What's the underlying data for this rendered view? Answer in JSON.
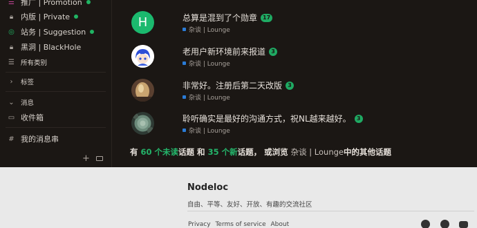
{
  "sidebar": {
    "items": [
      {
        "label": "推广 | Promotion",
        "icon": "list-icon",
        "dot": true
      },
      {
        "label": "内版 | Private",
        "icon": "lock-icon",
        "dot": true
      },
      {
        "label": "站务 | Suggestion",
        "icon": "target-icon",
        "dot": true
      },
      {
        "label": "黑洞 | BlackHole",
        "icon": "lock-icon",
        "dot": false
      },
      {
        "label": "所有类别",
        "icon": "list-icon",
        "dot": false
      }
    ],
    "tags_label": "标签",
    "messages_label": "消息",
    "inbox_label": "收件箱",
    "my_messages_label": "我的消息串"
  },
  "topics": [
    {
      "title": "总算是混到了个勋章",
      "count": "17",
      "category": "杂谈 | Lounge",
      "avatar_letter": "H",
      "avatar_color": "#1bb96e"
    },
    {
      "title": "老用户新环境前来报道",
      "count": "3",
      "category": "杂谈 | Lounge",
      "avatar_letter": "",
      "avatar_color": "#ffffff"
    },
    {
      "title": "非常好。注册后第二天改版",
      "count": "3",
      "category": "杂谈 | Lounge",
      "avatar_letter": "",
      "avatar_color": "#8a6a4a"
    },
    {
      "title": "聆听确实是最好的沟通方式，祝NL越来越好。",
      "count": "3",
      "category": "杂谈 | Lounge",
      "avatar_letter": "",
      "avatar_color": "#4a5a4a"
    }
  ],
  "suggest": {
    "prefix": "有",
    "unread": "60 个未读",
    "mid": "话题 和",
    "new": "35 个新",
    "suffix": "话题， 或浏览",
    "category": "杂谈 | Lounge",
    "tail": "中的其他话题"
  },
  "footer": {
    "title": "Nodeloc",
    "description": "自由、平等、友好、开放、有趣的交流社区",
    "links": [
      "Privacy",
      "Terms of service",
      "About"
    ]
  },
  "colors": {
    "accent": "#1faa63",
    "background": "#1b1714",
    "footer_bg": "#e9e9e9",
    "category_square": "#2a7bd6"
  }
}
